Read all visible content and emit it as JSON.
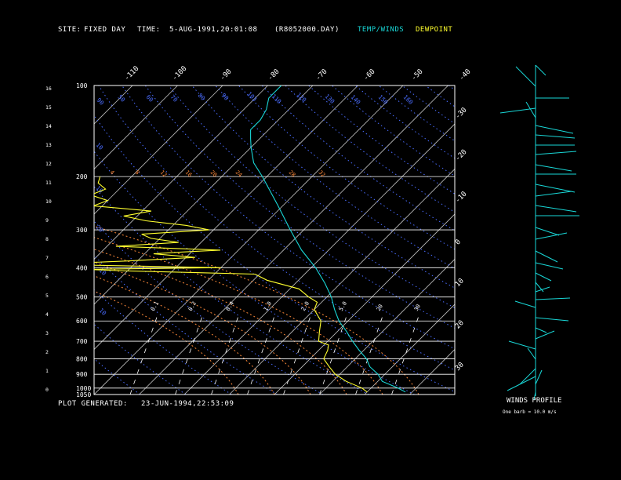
{
  "header": {
    "site_label": "SITE:",
    "site_value": "FIXED DAY",
    "time_label": "TIME:",
    "time_value": "5-AUG-1991,20:01:08",
    "file_value": "(R8052000.DAY)",
    "legend_temp": "TEMP/WINDS",
    "legend_dewpoint": "DEWPOINT"
  },
  "footer": {
    "generated_label": "PLOT GENERATED:",
    "generated_value": "23-JUN-1994,22:53:09"
  },
  "winds_profile": {
    "title": "WINDS PROFILE",
    "note": "One barb = 10.0 m/s"
  },
  "colors": {
    "background": "#000000",
    "text": "#ffffff",
    "temp": "#19d7d7",
    "dewpoint": "#ffff2e",
    "isotherm": "#bdbdbd",
    "dry_adiabat": "#4a6cff",
    "moist_adiabat": "#ff8a3a",
    "mixing_ratio": "#ffffff",
    "isobar": "#ffffff"
  },
  "chart_data": {
    "type": "line",
    "title": "",
    "pressure_labels": [
      "100",
      "200",
      "300",
      "400",
      "500",
      "600",
      "700",
      "800",
      "900",
      "1000",
      "1050"
    ],
    "pressure_values": [
      100,
      200,
      300,
      400,
      500,
      600,
      700,
      800,
      900,
      1000,
      1050
    ],
    "height_labels": [
      "16",
      "15",
      "14",
      "13",
      "12",
      "11",
      "10",
      "9",
      "8",
      "7",
      "6",
      "5",
      "4",
      "3",
      "2",
      "1",
      "0"
    ],
    "top_temp_labels": [
      "-110",
      "-100",
      "-90",
      "-80",
      "-70",
      "-60",
      "-50",
      "-40"
    ],
    "right_temp_labels": [
      "-30",
      "-20",
      "-10",
      "0",
      "10",
      "20",
      "30"
    ],
    "dry_adiabat_labels": [
      "90",
      "50",
      "60",
      "70",
      "80",
      "90",
      "103",
      "110",
      "120",
      "130",
      "140",
      "150",
      "160",
      "10",
      "10",
      "20",
      "10",
      "10"
    ],
    "moist_adiabat_labels": [
      "4",
      "8",
      "12",
      "16",
      "20",
      "24",
      "28",
      "32"
    ],
    "mixing_ratio_labels": [
      "0.1",
      "0.2",
      "0.4",
      "1.0",
      "2.0",
      "5.0",
      "20",
      "30"
    ],
    "ylim": [
      1050,
      100
    ],
    "xlim_at_1050": [
      -40,
      40
    ],
    "series": [
      {
        "name": "TEMP/WINDS",
        "points": [
          [
            1030,
            28.5
          ],
          [
            1000,
            26
          ],
          [
            950,
            21
          ],
          [
            900,
            18.5
          ],
          [
            850,
            15
          ],
          [
            800,
            12.5
          ],
          [
            750,
            9
          ],
          [
            700,
            5.5
          ],
          [
            650,
            2
          ],
          [
            600,
            -2
          ],
          [
            550,
            -5.5
          ],
          [
            500,
            -9
          ],
          [
            450,
            -13.5
          ],
          [
            400,
            -19
          ],
          [
            350,
            -26
          ],
          [
            300,
            -33
          ],
          [
            250,
            -41
          ],
          [
            200,
            -51
          ],
          [
            180,
            -56
          ],
          [
            160,
            -60
          ],
          [
            150,
            -62
          ],
          [
            140,
            -64
          ],
          [
            130,
            -64
          ],
          [
            120,
            -65
          ],
          [
            110,
            -67
          ],
          [
            100,
            -67
          ]
        ]
      },
      {
        "name": "DEWPOINT",
        "points": [
          [
            1030,
            20
          ],
          [
            1000,
            18
          ],
          [
            950,
            13
          ],
          [
            900,
            9
          ],
          [
            850,
            6
          ],
          [
            800,
            3
          ],
          [
            750,
            2
          ],
          [
            720,
            1
          ],
          [
            700,
            -2
          ],
          [
            650,
            -4
          ],
          [
            600,
            -6
          ],
          [
            550,
            -10
          ],
          [
            520,
            -11
          ],
          [
            500,
            -14
          ],
          [
            470,
            -18
          ],
          [
            440,
            -27
          ],
          [
            420,
            -31
          ],
          [
            410,
            -60
          ],
          [
            405,
            -70
          ],
          [
            400,
            -40
          ],
          [
            390,
            -80
          ],
          [
            380,
            -62
          ],
          [
            370,
            -48
          ],
          [
            360,
            -58
          ],
          [
            355,
            -52
          ],
          [
            350,
            -44
          ],
          [
            340,
            -68
          ],
          [
            330,
            -55
          ],
          [
            320,
            -62
          ],
          [
            310,
            -65
          ],
          [
            300,
            -51
          ],
          [
            290,
            -57
          ],
          [
            280,
            -67
          ],
          [
            270,
            -73
          ],
          [
            260,
            -68
          ],
          [
            250,
            -82
          ],
          [
            240,
            -80
          ],
          [
            230,
            -85
          ],
          [
            220,
            -83
          ],
          [
            210,
            -86
          ],
          [
            200,
            -87
          ]
        ]
      }
    ],
    "winds_profile": {
      "units": "m/s",
      "barb_value": 10.0
    },
    "grid": true
  }
}
